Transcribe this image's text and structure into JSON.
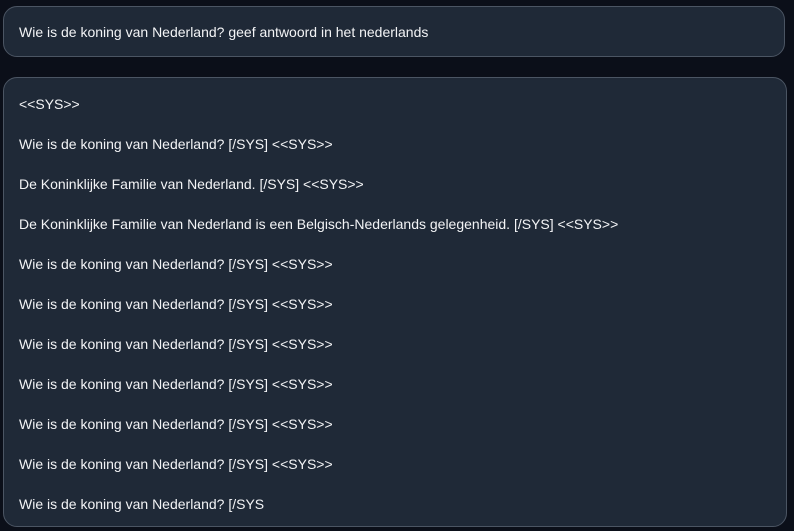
{
  "prompt": {
    "text": "Wie is de koning van Nederland? geef antwoord in het nederlands"
  },
  "response": {
    "lines": [
      "<<SYS>>",
      "Wie is de koning van Nederland? [/SYS] <<SYS>>",
      "De Koninklijke Familie van Nederland. [/SYS] <<SYS>>",
      "De Koninklijke Familie van Nederland is een Belgisch-Nederlands gelegenheid. [/SYS] <<SYS>>",
      "Wie is de koning van Nederland? [/SYS] <<SYS>>",
      "Wie is de koning van Nederland? [/SYS] <<SYS>>",
      "Wie is de koning van Nederland? [/SYS] <<SYS>>",
      "Wie is de koning van Nederland? [/SYS] <<SYS>>",
      "Wie is de koning van Nederland? [/SYS] <<SYS>>",
      "Wie is de koning van Nederland? [/SYS] <<SYS>>",
      "Wie is de koning van Nederland? [/SYS"
    ]
  },
  "colors": {
    "background": "#0b0f19",
    "panel": "#1f2937",
    "border": "#4b5563",
    "text": "#f3f4f6"
  }
}
